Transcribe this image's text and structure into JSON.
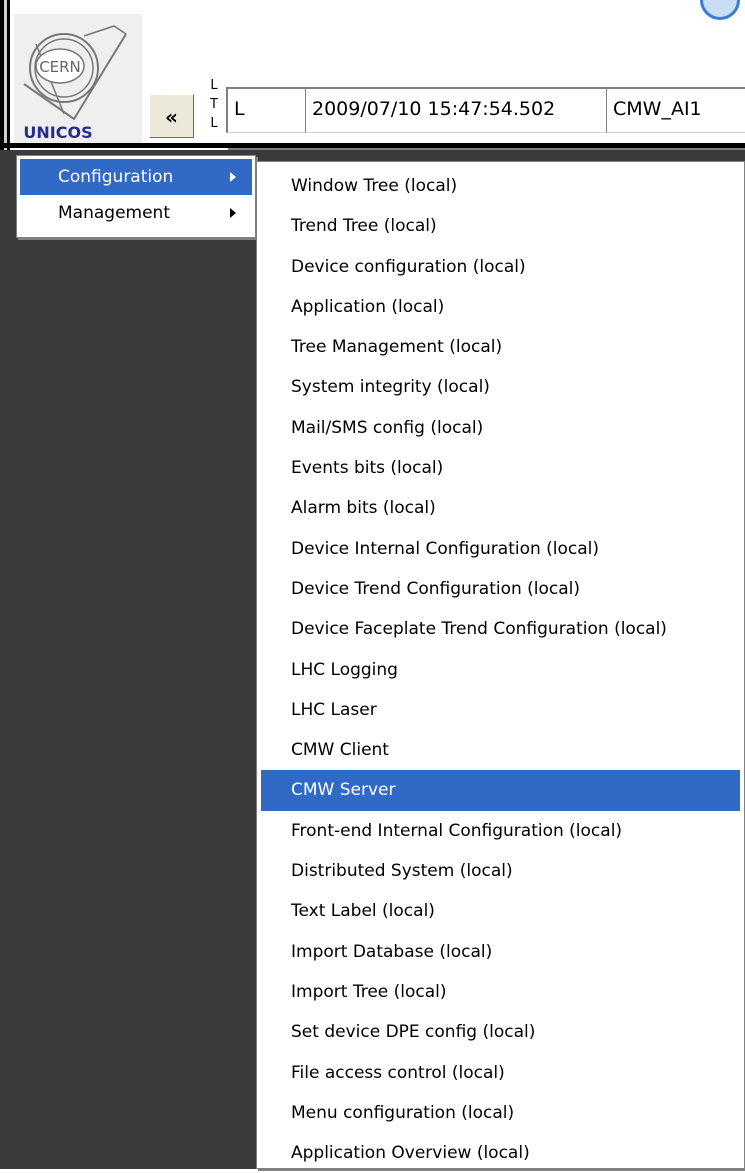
{
  "logo": {
    "name": "CERN UNICOS logo",
    "text_top": "CERN",
    "text_bottom": "UNICOS"
  },
  "toolbar": {
    "back_label": "«",
    "ltl_letters": [
      "L",
      "T",
      "L"
    ],
    "mode_value": "L",
    "timestamp_value": "2009/07/10 15:47:54.502",
    "device_value": "CMW_AI1"
  },
  "colors": {
    "selection": "#316ac5",
    "background_dark": "#3a3a3a",
    "menu_bg": "#ffffff"
  },
  "main_menu": {
    "items": [
      {
        "label": "Configuration",
        "selected": true,
        "has_submenu": true
      },
      {
        "label": "Management",
        "selected": false,
        "has_submenu": true
      }
    ]
  },
  "sub_menu": {
    "items": [
      {
        "label": "Window Tree (local)"
      },
      {
        "label": "Trend Tree (local)"
      },
      {
        "label": "Device configuration (local)"
      },
      {
        "label": "Application (local)"
      },
      {
        "label": "Tree Management (local)"
      },
      {
        "label": "System integrity (local)"
      },
      {
        "label": "Mail/SMS config (local)"
      },
      {
        "label": "Events bits (local)"
      },
      {
        "label": "Alarm bits (local)"
      },
      {
        "label": "Device Internal Configuration (local)"
      },
      {
        "label": "Device Trend Configuration (local)"
      },
      {
        "label": "Device Faceplate Trend Configuration (local)"
      },
      {
        "label": "LHC Logging"
      },
      {
        "label": "LHC Laser"
      },
      {
        "label": "CMW Client"
      },
      {
        "label": "CMW Server",
        "selected": true
      },
      {
        "label": "Front-end Internal Configuration (local)"
      },
      {
        "label": "Distributed System (local)"
      },
      {
        "label": "Text Label (local)"
      },
      {
        "label": "Import Database (local)"
      },
      {
        "label": "Import Tree (local)"
      },
      {
        "label": "Set device DPE config (local)"
      },
      {
        "label": "File access control (local)"
      },
      {
        "label": "Menu configuration (local)"
      },
      {
        "label": "Application Overview (local)"
      }
    ]
  }
}
